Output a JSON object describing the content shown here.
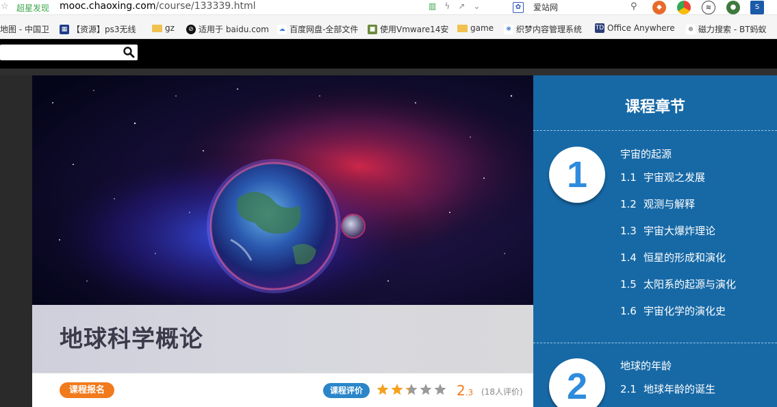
{
  "browser": {
    "discover_label": "超星发现",
    "url_host": "mooc.chaoxing.com",
    "url_path": "/course/133339.html",
    "search_site": "爱站网"
  },
  "bookmarks": [
    "地图 - 中国卫",
    "【资源】ps3无线",
    "gz",
    "适用于 baidu.com",
    "百度网盘-全部文件",
    "使用Vmware14安",
    "game",
    "织梦内容管理系统",
    "Office Anywhere",
    "磁力搜索 - BT蚂蚁"
  ],
  "course": {
    "title": "地球科学概论",
    "enroll_label": "课程报名",
    "rate_label": "课程评价",
    "score_main": "2",
    "score_decimal": ".3",
    "rating_count": "(18人评价)",
    "stars": 2.3,
    "star_color": "#f5a11d"
  },
  "chapters": {
    "heading": "课程章节",
    "list": [
      {
        "number": "1",
        "title": "宇宙的起源",
        "lessons": [
          {
            "num": "1.1",
            "title": "宇宙观之发展"
          },
          {
            "num": "1.2",
            "title": "观测与解释"
          },
          {
            "num": "1.3",
            "title": "宇宙大爆炸理论"
          },
          {
            "num": "1.4",
            "title": "恒星的形成和演化"
          },
          {
            "num": "1.5",
            "title": "太阳系的起源与演化"
          },
          {
            "num": "1.6",
            "title": "宇宙化学的演化史"
          }
        ]
      },
      {
        "number": "2",
        "title": "地球的年龄",
        "lessons": [
          {
            "num": "2.1",
            "title": "地球年龄的诞生"
          }
        ]
      }
    ]
  },
  "colors": {
    "panel_blue": "#1769a6",
    "enroll_orange": "#f17a1d",
    "rate_blue": "#2a86c9"
  }
}
